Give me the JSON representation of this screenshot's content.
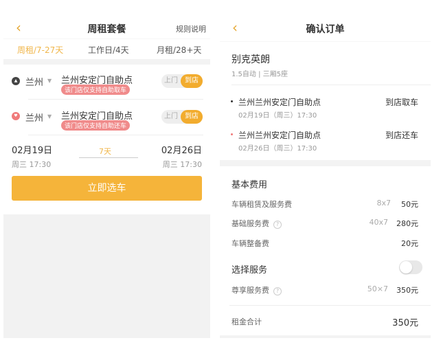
{
  "left": {
    "title": "周租套餐",
    "rules": "规则说明",
    "tabs": [
      {
        "label": "周租/7-27天"
      },
      {
        "label": "工作日/4天"
      },
      {
        "label": "月租/28+天"
      }
    ],
    "pickup": {
      "city": "兰州",
      "store": "兰州安定门自助点",
      "tag": "该门店仅支持自助取车",
      "opt_off": "上门",
      "opt_on": "到店"
    },
    "return": {
      "city": "兰州",
      "store": "兰州安定门自助点",
      "tag": "该门店仅支持自助还车",
      "opt_off": "上门",
      "opt_on": "到店"
    },
    "start": {
      "date": "02月19日",
      "time": "周三 17:30"
    },
    "end": {
      "date": "02月26日",
      "time": "周三 17:30"
    },
    "duration": "7天",
    "button": "立即选车"
  },
  "right": {
    "title": "确认订单",
    "car": {
      "name": "别克英朗",
      "spec": "1.5自动 | 三厢5座"
    },
    "pickup": {
      "store": "兰州兰州安定门自助点",
      "time": "02月19日（周三）17:30",
      "mode": "到店取车"
    },
    "return": {
      "store": "兰州兰州安定门自助点",
      "time": "02月26日（周三）17:30",
      "mode": "到店还车"
    },
    "fees_title": "基本费用",
    "fees": [
      {
        "label": "车辆租赁及服务费",
        "mul": "8x7",
        "value": "50元"
      },
      {
        "label": "基础服务费",
        "mul": "40x7",
        "value": "280元"
      },
      {
        "label": "车辆整备费",
        "mul": "",
        "value": "20元"
      }
    ],
    "service_title": "选择服务",
    "service_toggle_on": false,
    "service": {
      "label": "尊享服务费",
      "mul": "50×7",
      "value": "350元"
    },
    "total_label": "租金合计",
    "total": "350元",
    "help": "?"
  }
}
